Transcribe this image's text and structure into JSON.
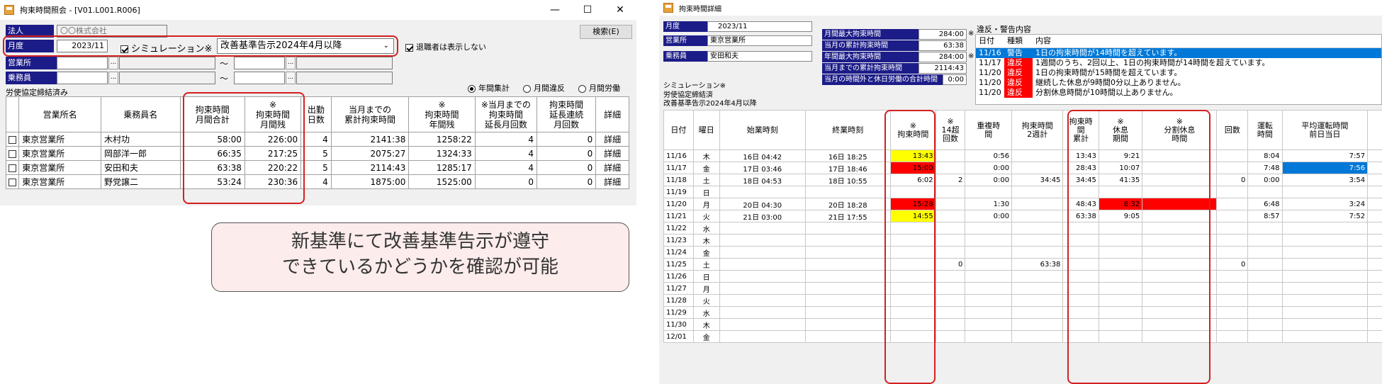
{
  "left_window": {
    "title": "拘束時間照会 - [V01.L001.R006]",
    "controls": {
      "minimize": "—",
      "maximize": "☐",
      "close": "✕"
    },
    "corp_label": "法人",
    "corp_value": "〇〇株式会社",
    "month_label": "月度",
    "month_value": "2023/11",
    "simulation_label": "シミュレーション※",
    "standard_value": "改善基準告示2024年4月以降",
    "retired_label": "退職者は表示しない",
    "search_button": "検索(E)",
    "office_label": "営業所",
    "crew_label": "乗務員",
    "tilde": "〜",
    "ellipsis": "...",
    "agreement_note": "労使協定締結済み",
    "radio_annual": "年間集計",
    "radio_monthly": "月間違反",
    "radio_labor": "月間労働",
    "table_headers": [
      "",
      "営業所名",
      "乗務員名",
      "拘束時間\n月間合計",
      "※\n拘束時間\n月間残",
      "出勤\n日数",
      "当月までの\n累計拘束時間",
      "※\n拘束時間\n年間残",
      "※当月までの\n拘束時間\n延長月回数",
      "拘束時間\n延長連続\n月回数",
      "詳細"
    ],
    "rows": [
      {
        "office": "東京営業所",
        "name": "木村功",
        "monthly_total": "58:00",
        "monthly_remain": "226:00",
        "days": "4",
        "cumulative": "2141:38",
        "annual_remain": "1258:22",
        "ext_count": "4",
        "ext_consec": "0",
        "detail": "詳細"
      },
      {
        "office": "東京営業所",
        "name": "岡部洋一郎",
        "monthly_total": "66:35",
        "monthly_remain": "217:25",
        "days": "5",
        "cumulative": "2075:27",
        "annual_remain": "1324:33",
        "ext_count": "4",
        "ext_consec": "0",
        "detail": "詳細"
      },
      {
        "office": "東京営業所",
        "name": "安田和夫",
        "monthly_total": "63:38",
        "monthly_remain": "220:22",
        "days": "5",
        "cumulative": "2114:43",
        "annual_remain": "1285:17",
        "ext_count": "4",
        "ext_consec": "0",
        "detail": "詳細"
      },
      {
        "office": "東京営業所",
        "name": "野党譲二",
        "monthly_total": "53:24",
        "monthly_remain": "230:36",
        "days": "4",
        "cumulative": "1875:00",
        "annual_remain": "1525:00",
        "ext_count": "0",
        "ext_consec": "0",
        "detail": "詳細"
      }
    ]
  },
  "callout": {
    "line1": "新基準にて改善基準告示が遵守",
    "line2": "できているかどうかを確認が可能"
  },
  "right_window": {
    "title": "拘束時間詳細",
    "month_label": "月度",
    "month_value": "2023/11",
    "office_label": "営業所",
    "office_value": "東京営業所",
    "crew_label": "乗務員",
    "crew_value": "安田和夫",
    "sim_line1": "シミュレーション※",
    "sim_line2": "労使協定締結済",
    "sim_line3": "改善基準告示2024年4月以降",
    "stats": [
      {
        "label": "月間最大拘束時間",
        "value": "284:00",
        "mark": "※"
      },
      {
        "label": "当月の累計拘束時間",
        "value": "63:38",
        "mark": ""
      },
      {
        "label": "年間最大拘束時間",
        "value": "284:00",
        "mark": "※"
      },
      {
        "label": "当月までの累計拘束時間",
        "value": "2114:43",
        "mark": ""
      },
      {
        "label": "当月の時間外と休日労働の合計時間",
        "value": "0:00",
        "mark": ""
      }
    ],
    "warn_title": "違反・警告内容",
    "warn_headers": [
      "日付",
      "種類",
      "内容"
    ],
    "warnings": [
      {
        "date": "11/16",
        "type": "警告",
        "text": "1日の拘束時間が14時間を超えています。"
      },
      {
        "date": "11/17",
        "type": "違反",
        "text": "1週間のうち、2回以上、1日の拘束時間が14時間を超えています。"
      },
      {
        "date": "11/20",
        "type": "違反",
        "text": "1日の拘束時間が15時間を超えています。"
      },
      {
        "date": "11/20",
        "type": "違反",
        "text": "継続した休息が9時間0分以上ありません。"
      },
      {
        "date": "11/20",
        "type": "違反",
        "text": "分割休息時間が10時間以上ありません。"
      }
    ],
    "headers": [
      "日付",
      "曜日",
      "始業時刻",
      "終業時刻",
      "※\n拘束時間",
      "※\n14超\n回数",
      "重複時\n間",
      "拘束時間\n2週計",
      "拘束時\n間\n累計",
      "※\n休息\n期間",
      "※\n分割休息\n時間",
      "回数",
      "運転\n時間",
      "平均運転時間\n前日当日",
      "平均"
    ],
    "rows": [
      {
        "d": "11/16",
        "w": "木",
        "s": "16日 04:42",
        "e": "16日 18:25",
        "k": "13:43",
        "o": "",
        "dup": "0:56",
        "two": "",
        "cum": "13:43",
        "rest": "9:21",
        "split": "",
        "n": "",
        "drv": "8:04",
        "avg": "7:57",
        "hl": "yellow",
        "hlr": "",
        "hla": ""
      },
      {
        "d": "11/17",
        "w": "金",
        "s": "17日 03:46",
        "e": "17日 18:46",
        "k": "15:00",
        "o": "",
        "dup": "0:00",
        "two": "",
        "cum": "28:43",
        "rest": "10:07",
        "split": "",
        "n": "",
        "drv": "7:48",
        "avg": "7:56",
        "hl": "red",
        "hlr": "",
        "hla": "blue"
      },
      {
        "d": "11/18",
        "w": "土",
        "s": "18日 04:53",
        "e": "18日 10:55",
        "k": "6:02",
        "o": "2",
        "dup": "0:00",
        "two": "34:45",
        "cum": "34:45",
        "rest": "41:35",
        "split": "",
        "n": "0",
        "drv": "0:00",
        "avg": "3:54",
        "hl": "",
        "hlr": "",
        "hla": ""
      },
      {
        "d": "11/19",
        "w": "日",
        "s": "",
        "e": "",
        "k": "",
        "o": "",
        "dup": "",
        "two": "",
        "cum": "",
        "rest": "",
        "split": "",
        "n": "",
        "drv": "",
        "avg": "",
        "hl": "",
        "hlr": "",
        "hla": ""
      },
      {
        "d": "11/20",
        "w": "月",
        "s": "20日 04:30",
        "e": "20日 18:28",
        "k": "15:28",
        "o": "",
        "dup": "1:30",
        "two": "",
        "cum": "48:43",
        "rest": "8:32",
        "split": "",
        "n": "",
        "drv": "6:48",
        "avg": "3:24",
        "hl": "red",
        "hlr": "red",
        "hla": ""
      },
      {
        "d": "11/21",
        "w": "火",
        "s": "21日 03:00",
        "e": "21日 17:55",
        "k": "14:55",
        "o": "",
        "dup": "0:00",
        "two": "",
        "cum": "63:38",
        "rest": "9:05",
        "split": "",
        "n": "",
        "drv": "8:57",
        "avg": "7:52",
        "hl": "yellow",
        "hlr": "",
        "hla": ""
      },
      {
        "d": "11/22",
        "w": "水",
        "s": "",
        "e": "",
        "k": "",
        "o": "",
        "dup": "",
        "two": "",
        "cum": "",
        "rest": "",
        "split": "",
        "n": "",
        "drv": "",
        "avg": "",
        "hl": "",
        "hlr": "",
        "hla": ""
      },
      {
        "d": "11/23",
        "w": "木",
        "s": "",
        "e": "",
        "k": "",
        "o": "",
        "dup": "",
        "two": "",
        "cum": "",
        "rest": "",
        "split": "",
        "n": "",
        "drv": "",
        "avg": "",
        "hl": "",
        "hlr": "",
        "hla": ""
      },
      {
        "d": "11/24",
        "w": "金",
        "s": "",
        "e": "",
        "k": "",
        "o": "",
        "dup": "",
        "two": "",
        "cum": "",
        "rest": "",
        "split": "",
        "n": "",
        "drv": "",
        "avg": "",
        "hl": "",
        "hlr": "",
        "hla": ""
      },
      {
        "d": "11/25",
        "w": "土",
        "s": "",
        "e": "",
        "k": "",
        "o": "0",
        "dup": "",
        "two": "63:38",
        "cum": "",
        "rest": "",
        "split": "",
        "n": "0",
        "drv": "",
        "avg": "",
        "hl": "",
        "hlr": "",
        "hla": ""
      },
      {
        "d": "11/26",
        "w": "日",
        "s": "",
        "e": "",
        "k": "",
        "o": "",
        "dup": "",
        "two": "",
        "cum": "",
        "rest": "",
        "split": "",
        "n": "",
        "drv": "",
        "avg": "",
        "hl": "",
        "hlr": "",
        "hla": ""
      },
      {
        "d": "11/27",
        "w": "月",
        "s": "",
        "e": "",
        "k": "",
        "o": "",
        "dup": "",
        "two": "",
        "cum": "",
        "rest": "",
        "split": "",
        "n": "",
        "drv": "",
        "avg": "",
        "hl": "",
        "hlr": "",
        "hla": ""
      },
      {
        "d": "11/28",
        "w": "火",
        "s": "",
        "e": "",
        "k": "",
        "o": "",
        "dup": "",
        "two": "",
        "cum": "",
        "rest": "",
        "split": "",
        "n": "",
        "drv": "",
        "avg": "",
        "hl": "",
        "hlr": "",
        "hla": ""
      },
      {
        "d": "11/29",
        "w": "水",
        "s": "",
        "e": "",
        "k": "",
        "o": "",
        "dup": "",
        "two": "",
        "cum": "",
        "rest": "",
        "split": "",
        "n": "",
        "drv": "",
        "avg": "",
        "hl": "",
        "hlr": "",
        "hla": ""
      },
      {
        "d": "11/30",
        "w": "木",
        "s": "",
        "e": "",
        "k": "",
        "o": "",
        "dup": "",
        "two": "",
        "cum": "",
        "rest": "",
        "split": "",
        "n": "",
        "drv": "",
        "avg": "",
        "hl": "",
        "hlr": "",
        "hla": ""
      },
      {
        "d": "12/01",
        "w": "金",
        "s": "",
        "e": "",
        "k": "",
        "o": "",
        "dup": "",
        "two": "",
        "cum": "",
        "rest": "",
        "split": "",
        "n": "",
        "drv": "",
        "avg": "",
        "hl": "",
        "hlr": "",
        "hla": ""
      }
    ]
  },
  "colors": {
    "label_blue": "#1c1c88",
    "highlight_red": "#ff0000",
    "highlight_yellow": "#ffff00",
    "highlight_blue": "#0078d7",
    "annotation_red": "#d42020",
    "callout_bg": "#fcecec"
  }
}
